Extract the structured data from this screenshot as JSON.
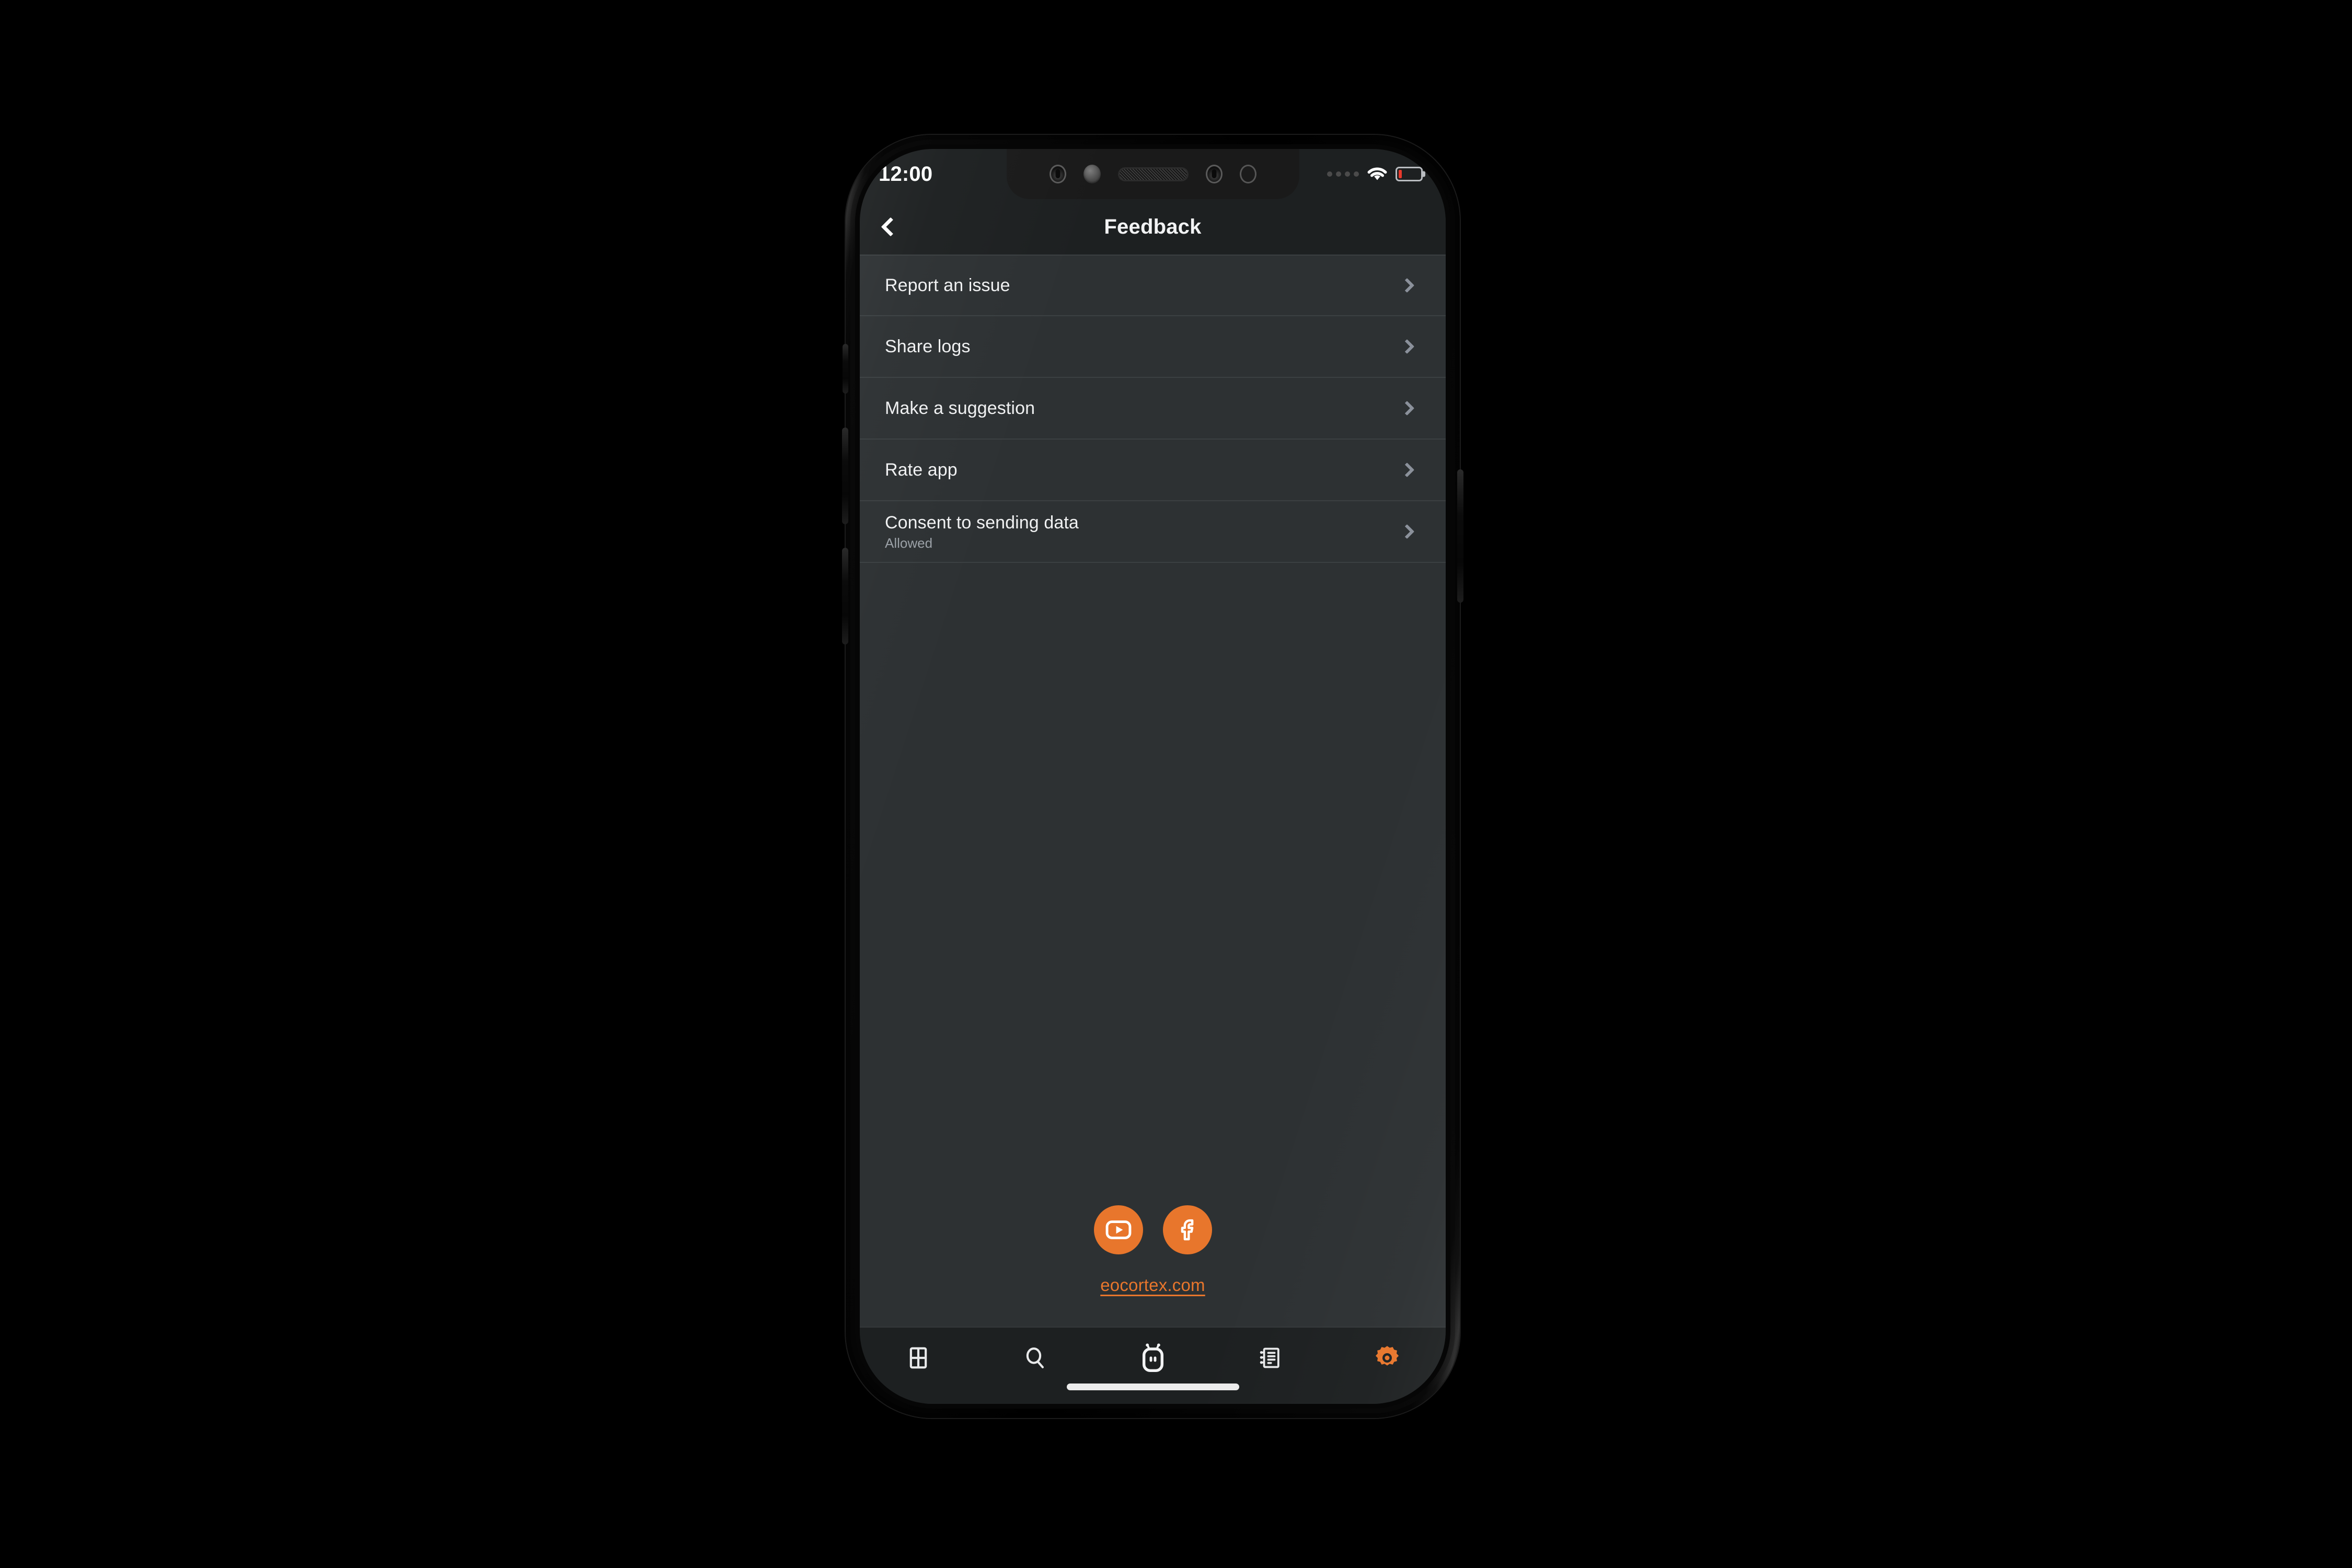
{
  "device": {
    "type": "smartphone-mockup",
    "orientation": "portrait"
  },
  "status_bar": {
    "time": "12:00",
    "signal_icon": "cellular-dots-icon",
    "wifi_icon": "wifi-icon",
    "battery_icon": "battery-low-icon",
    "battery_level_percent": 10,
    "battery_color": "#e8392c"
  },
  "header": {
    "back_icon": "back-chevron-icon",
    "title": "Feedback"
  },
  "theme": {
    "accent": "#e8762c",
    "screen_bg": "#1d2021",
    "content_bg": "#2d3133",
    "divider": "#3b4042",
    "text_primary": "#f0f1f2",
    "text_secondary": "#9aa0a6",
    "chevron": "#8b919b"
  },
  "list": {
    "items": [
      {
        "title": "Report an issue",
        "subtitle": "",
        "chevron_icon": "chevron-right-icon"
      },
      {
        "title": "Share logs",
        "subtitle": "",
        "chevron_icon": "chevron-right-icon"
      },
      {
        "title": "Make a suggestion",
        "subtitle": "",
        "chevron_icon": "chevron-right-icon"
      },
      {
        "title": "Rate app",
        "subtitle": "",
        "chevron_icon": "chevron-right-icon"
      },
      {
        "title": "Consent to sending data",
        "subtitle": "Allowed",
        "chevron_icon": "chevron-right-icon"
      }
    ]
  },
  "footer": {
    "social": [
      {
        "name": "youtube-icon",
        "label": "YouTube"
      },
      {
        "name": "facebook-icon",
        "label": "Facebook"
      }
    ],
    "website_link": "eocortex.com"
  },
  "tabbar": {
    "items": [
      {
        "name": "grid-icon",
        "label": "Views",
        "active": false
      },
      {
        "name": "search-icon",
        "label": "Search",
        "active": false
      },
      {
        "name": "robot-icon",
        "label": "Assistant",
        "active": false
      },
      {
        "name": "journal-icon",
        "label": "Events",
        "active": false
      },
      {
        "name": "gear-icon",
        "label": "Settings",
        "active": true
      }
    ]
  },
  "home_indicator": {
    "visible": true
  }
}
